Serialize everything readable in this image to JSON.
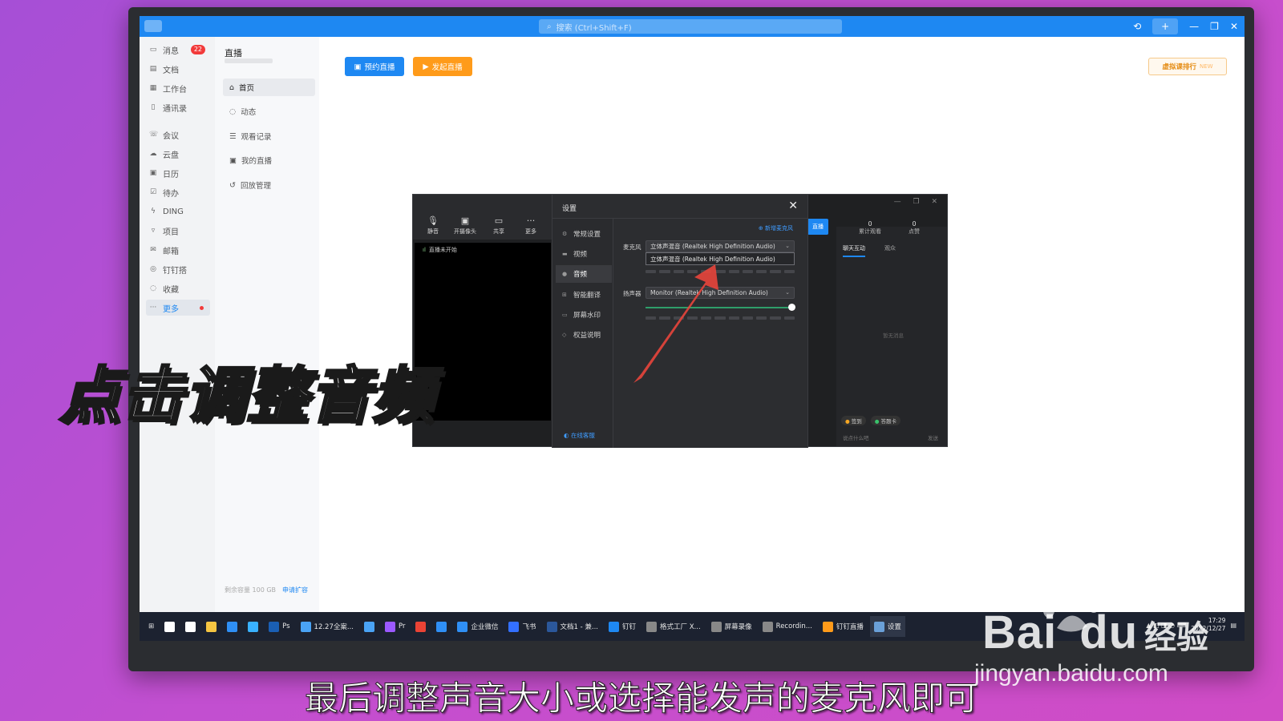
{
  "app": {
    "search_placeholder": "搜索 (Ctrl+Shift+F)",
    "plus_label": "+"
  },
  "nav1": {
    "items": [
      {
        "label": "消息",
        "icon": "chat-icon",
        "badge": "22"
      },
      {
        "label": "文档",
        "icon": "doc-icon"
      },
      {
        "label": "工作台",
        "icon": "grid-icon"
      },
      {
        "label": "通讯录",
        "icon": "contacts-icon"
      },
      {
        "label": "会议",
        "icon": "phone-icon"
      },
      {
        "label": "云盘",
        "icon": "cloud-icon"
      },
      {
        "label": "日历",
        "icon": "calendar-icon"
      },
      {
        "label": "待办",
        "icon": "todo-icon"
      },
      {
        "label": "DING",
        "icon": "ding-icon"
      },
      {
        "label": "项目",
        "icon": "project-icon"
      },
      {
        "label": "邮箱",
        "icon": "mail-icon"
      },
      {
        "label": "钉钉搭",
        "icon": "builder-icon"
      },
      {
        "label": "收藏",
        "icon": "star-icon"
      },
      {
        "label": "更多",
        "icon": "more-icon"
      }
    ]
  },
  "nav2": {
    "title": "直播",
    "items": [
      {
        "label": "首页",
        "icon": "home-icon"
      },
      {
        "label": "动态",
        "icon": "feed-icon"
      },
      {
        "label": "观看记录",
        "icon": "history-icon"
      },
      {
        "label": "我的直播",
        "icon": "mylive-icon"
      },
      {
        "label": "回放管理",
        "icon": "replay-icon"
      }
    ],
    "storage": "剩余容量 100 GB",
    "expand_link": "申请扩容"
  },
  "main": {
    "schedule_btn": "预约直播",
    "start_btn": "发起直播",
    "rank_btn": "虚拟课排行",
    "rank_new": "NEW"
  },
  "live_window": {
    "tools": [
      {
        "label": "静音",
        "icon": "mic-icon"
      },
      {
        "label": "开摄像头",
        "icon": "camera-icon"
      },
      {
        "label": "共享",
        "icon": "screen-share-icon"
      },
      {
        "label": "更多",
        "icon": "more-dots-icon"
      }
    ],
    "status": "直播未开始",
    "live_btn": "直播",
    "stats": [
      {
        "value": "0",
        "label": "累计观看"
      },
      {
        "value": "0",
        "label": "点赞"
      }
    ],
    "tabs": [
      "聊天互动",
      "观众"
    ],
    "empty_msg": "暂无消息",
    "tag1": "签到",
    "tag2": "答题卡",
    "input_placeholder": "说点什么吧",
    "send": "发送"
  },
  "settings": {
    "title": "设置",
    "close": "✕",
    "side_items": [
      {
        "label": "常规设置",
        "icon": "gear-icon"
      },
      {
        "label": "视频",
        "icon": "video-icon"
      },
      {
        "label": "音频",
        "icon": "audio-icon"
      },
      {
        "label": "智能翻译",
        "icon": "translate-icon"
      },
      {
        "label": "屏幕水印",
        "icon": "watermark-icon"
      },
      {
        "label": "权益说明",
        "icon": "rights-icon"
      }
    ],
    "help_link": "在线客服",
    "add_mic": "新增麦克风",
    "mic_label": "麦克风",
    "mic_value": "立体声混音 (Realtek High Definition Audio)",
    "mic_option": "立体声混音 (Realtek High Definition Audio)",
    "speaker_label": "扬声器",
    "speaker_value": "Monitor (Realtek High Definition Audio)",
    "speaker_volume": 1.0
  },
  "taskbar": {
    "items": [
      {
        "label": "",
        "color": "#ffffff"
      },
      {
        "label": "",
        "color": "#ffffff"
      },
      {
        "label": "",
        "color": "#f5c542"
      },
      {
        "label": "",
        "color": "#2f8ff5"
      },
      {
        "label": "",
        "color": "#39b1ff"
      },
      {
        "label": "Ps",
        "color": "#1a5fb4"
      },
      {
        "label": "12.27全案...",
        "color": "#4aa3f5"
      },
      {
        "label": "",
        "color": "#4aa3f5"
      },
      {
        "label": "Pr",
        "color": "#9b59ff"
      },
      {
        "label": "",
        "color": "#ea4335"
      },
      {
        "label": "",
        "color": "#2f8ff5"
      },
      {
        "label": "企业微信",
        "color": "#2f8ff5"
      },
      {
        "label": "飞书",
        "color": "#3370ff"
      },
      {
        "label": "文档1 - 兼...",
        "color": "#2b579a"
      },
      {
        "label": "钉钉",
        "color": "#1e88f2"
      },
      {
        "label": "格式工厂 X...",
        "color": "#888888"
      },
      {
        "label": "屏幕录像",
        "color": "#888888"
      },
      {
        "label": "Recordin...",
        "color": "#888888"
      },
      {
        "label": "钉钉直播",
        "color": "#ff9b1a"
      },
      {
        "label": "设置",
        "color": "#6aa0d8"
      }
    ],
    "time": "17:29",
    "date": "2022/12/27"
  },
  "overlay": {
    "caption": "点击调整音频",
    "subtitle": "最后调整声音大小或选择能发声的麦克风即可"
  },
  "watermark": {
    "brand": "Bai",
    "du": "du",
    "jingyan": "经验",
    "url": "jingyan.baidu.com"
  },
  "colors": {
    "accent": "#1e88f2",
    "orange": "#ff9b1a",
    "arrow": "#e8453c"
  }
}
